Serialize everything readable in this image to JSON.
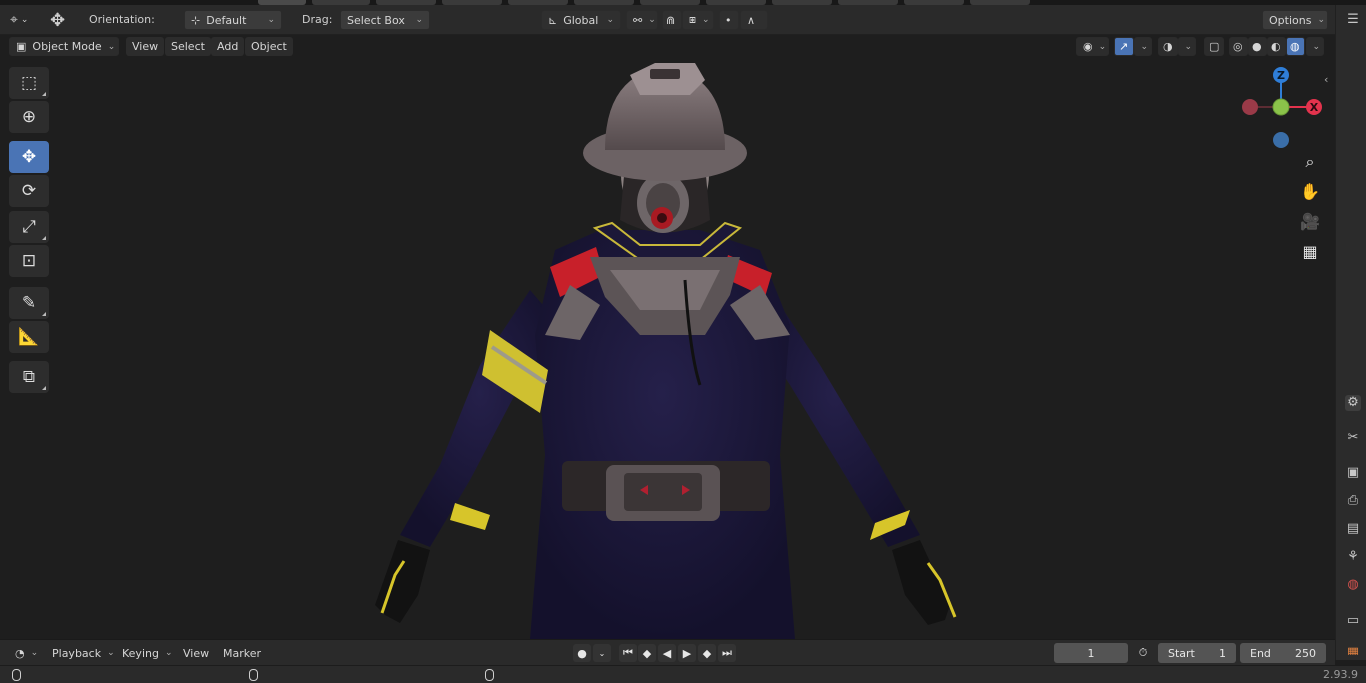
{
  "header": {
    "orientation_label": "Orientation:",
    "orientation_value": "Default",
    "drag_label": "Drag:",
    "drag_value": "Select Box",
    "transform_space": "Global",
    "options_label": "Options"
  },
  "viewport_header": {
    "mode": "Object Mode",
    "menus": [
      "View",
      "Select",
      "Add",
      "Object"
    ]
  },
  "toolbar": {
    "tools": [
      {
        "icon": "select-box-icon",
        "active": false
      },
      {
        "icon": "cursor-icon",
        "active": false
      },
      {
        "icon": "move-icon",
        "active": true
      },
      {
        "icon": "rotate-icon",
        "active": false
      },
      {
        "icon": "scale-icon",
        "active": false
      },
      {
        "icon": "transform-icon",
        "active": false
      },
      {
        "icon": "annotate-icon",
        "active": false
      },
      {
        "icon": "measure-icon",
        "active": false
      },
      {
        "icon": "add-cube-icon",
        "active": false
      }
    ]
  },
  "gizmo": {
    "axis_z": "Z",
    "axis_x": "X",
    "colors": {
      "x": "#e3334d",
      "y": "#8bc34a",
      "z": "#2f7ed8",
      "neg_x": "#9a3a48",
      "neg_z": "#3a6ea8"
    }
  },
  "navigation": {
    "icons": [
      "zoom-icon",
      "pan-hand-icon",
      "camera-icon",
      "perspective-grid-icon"
    ]
  },
  "timeline": {
    "menus": [
      "Playback",
      "Keying",
      "View",
      "Marker"
    ],
    "current_frame": "1",
    "start_label": "Start",
    "start_value": "1",
    "end_label": "End",
    "end_value": "250"
  },
  "status": {
    "version": "2.93.9"
  },
  "colors": {
    "accent": "#4a74b5",
    "viewport_bg": "#1e1e1e",
    "header_bg": "#2a2a2a"
  }
}
